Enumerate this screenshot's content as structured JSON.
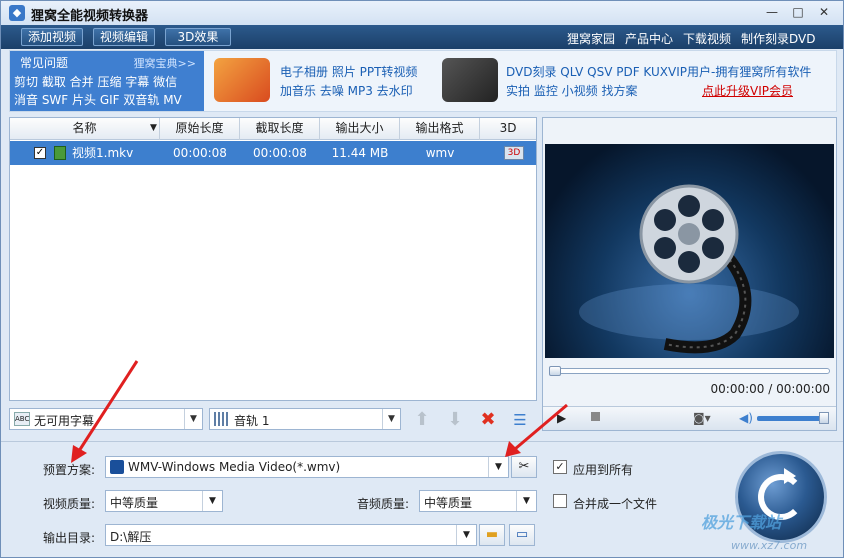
{
  "window": {
    "title": "狸窝全能视频转换器",
    "minimize": "—",
    "restore": "□",
    "close": "✕"
  },
  "menubar": {
    "buttons": [
      "添加视频",
      "视频编辑",
      "3D效果"
    ],
    "links": [
      "狸窝家园",
      "产品中心",
      "下载视频",
      "制作刻录DVD"
    ]
  },
  "adbar": {
    "faq_title": "常见问题",
    "faq_more": "狸窝宝典>>",
    "faq_row1": "剪切 截取 合并 压缩 字幕 微信",
    "faq_row2": "消音 SWF 片头 GIF 双音轨 MV",
    "ad1_row1": "电子相册 照片 PPT转视频",
    "ad1_row2": "加音乐 去噪 MP3 去水印",
    "ad2_row1": "DVD刻录 QLV QSV PDF KUX",
    "ad2_row2": "实拍 监控 小视频 找方案",
    "vip_title": "VIP用户-拥有狸窝所有软件",
    "vip_link": "点此升级VIP会员"
  },
  "filelist": {
    "headers": [
      "名称",
      "原始长度",
      "截取长度",
      "输出大小",
      "输出格式",
      "3D"
    ],
    "rows": [
      {
        "checked": "✓",
        "name": "视频1.mkv",
        "original": "00:00:08",
        "clip": "00:00:08",
        "size": "11.44 MB",
        "format": "wmv",
        "badge3d": "3D"
      }
    ]
  },
  "tracks": {
    "subtitle": "无可用字幕",
    "audio": "音轨 1"
  },
  "preview": {
    "time": "00:00:00 / 00:00:00"
  },
  "settings": {
    "preset_label": "预置方案:",
    "preset_value": "WMV-Windows Media Video(*.wmv)",
    "apply_all_label": "应用到所有",
    "apply_all_checked": "✓",
    "video_quality_label": "视频质量:",
    "video_quality_value": "中等质量",
    "audio_quality_label": "音频质量:",
    "audio_quality_value": "中等质量",
    "merge_label": "合并成一个文件",
    "output_dir_label": "输出目录:",
    "output_dir_value": "D:\\解压"
  },
  "watermark": {
    "text": "极光下载站",
    "url": "www.xz7.com"
  },
  "colors": {
    "accent": "#3d7fce",
    "menubar": "#1b3f69",
    "annotation_arrow": "#e02020"
  }
}
